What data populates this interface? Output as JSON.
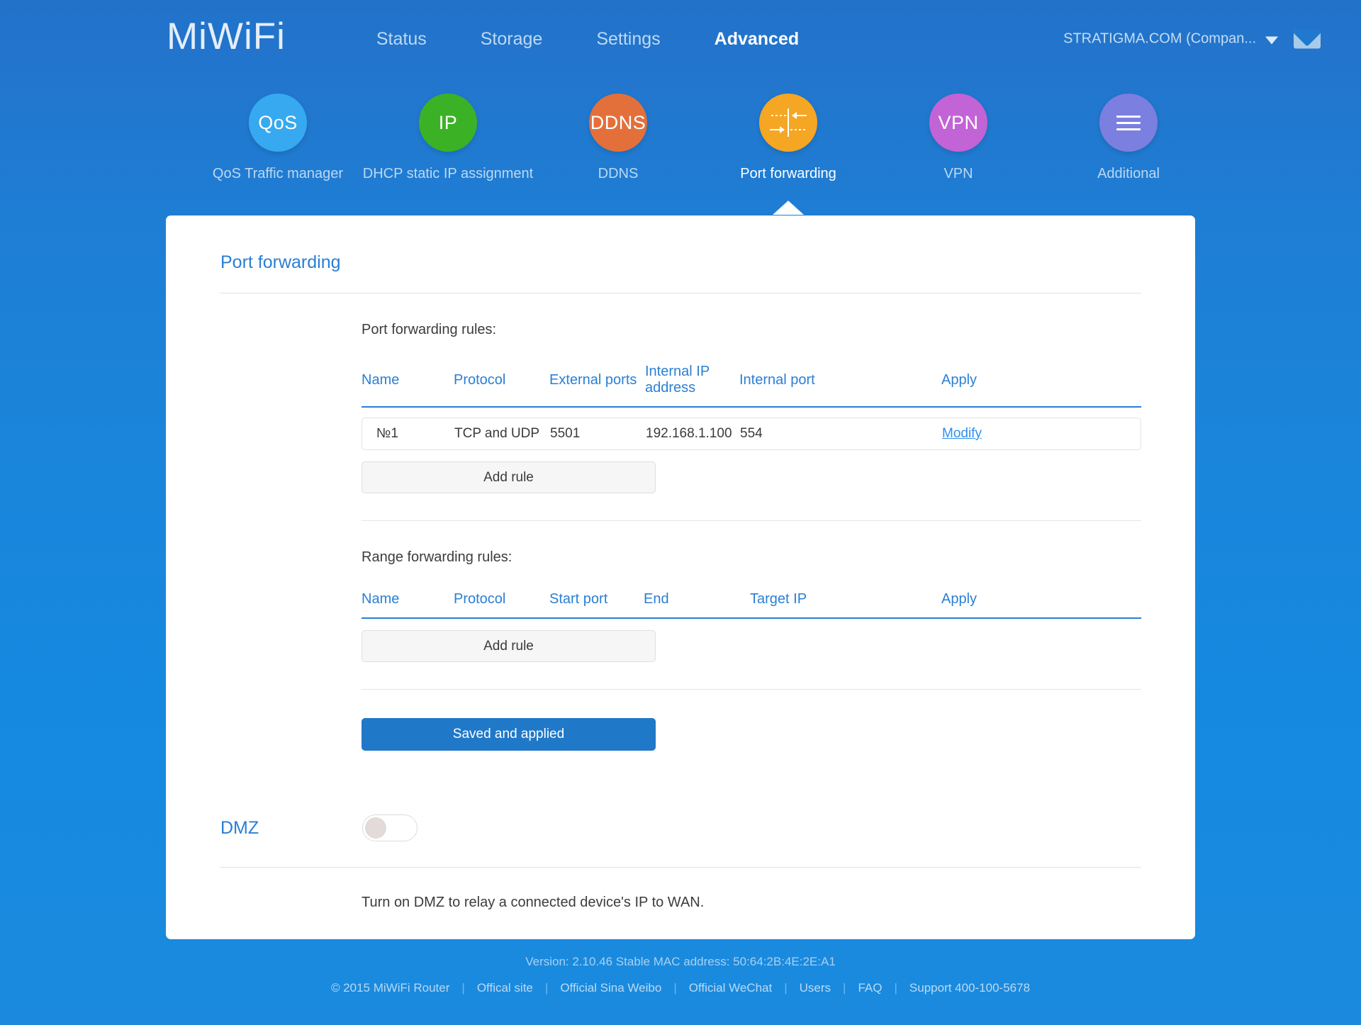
{
  "header": {
    "brand": "MiWiFi",
    "nav": [
      {
        "label": "Status",
        "active": false
      },
      {
        "label": "Storage",
        "active": false
      },
      {
        "label": "Settings",
        "active": false
      },
      {
        "label": "Advanced",
        "active": true
      }
    ],
    "account": "STRATIGMA.COM (Compan...",
    "chevron_icon": "chevron-down-icon",
    "mail_icon": "envelope-icon"
  },
  "iconnav": [
    {
      "glyph": "QoS",
      "caption": "QoS Traffic manager",
      "color": "#36a9f0",
      "icon": "qos-icon"
    },
    {
      "glyph": "IP",
      "caption": "DHCP static IP assignment",
      "color": "#3bb226",
      "icon": "ip-icon"
    },
    {
      "glyph": "DDNS",
      "caption": "DDNS",
      "color": "#e3703a",
      "icon": "ddns-icon"
    },
    {
      "glyph": "",
      "caption": "Port forwarding",
      "color": "#f5a623",
      "icon": "port-forwarding-icon"
    },
    {
      "glyph": "VPN",
      "caption": "VPN",
      "color": "#c263d6",
      "icon": "vpn-icon"
    },
    {
      "glyph": "",
      "caption": "Additional",
      "color": "#7b7fe0",
      "icon": "hamburger-icon"
    }
  ],
  "panel": {
    "title": "Port forwarding",
    "port_rules": {
      "label": "Port forwarding rules:",
      "columns": [
        "Name",
        "Protocol",
        "External ports",
        "Internal IP address",
        "Internal port",
        "Apply"
      ],
      "rows": [
        {
          "name": "№1",
          "protocol": "TCP and UDP",
          "external_ports": "5501",
          "internal_ip": "192.168.1.100",
          "internal_port": "554",
          "apply": "Modify"
        }
      ],
      "add_label": "Add rule"
    },
    "range_rules": {
      "label": "Range forwarding rules:",
      "columns": [
        "Name",
        "Protocol",
        "Start port",
        "End",
        "Target IP",
        "Apply"
      ],
      "rows": [],
      "add_label": "Add rule"
    },
    "save_label": "Saved and applied",
    "dmz": {
      "label": "DMZ",
      "enabled": false,
      "description": "Turn on DMZ to relay a connected device's IP to WAN."
    }
  },
  "footer": {
    "version": "Version: 2.10.46 Stable  MAC address: 50:64:2B:4E:2E:A1",
    "copyright": "© 2015 MiWiFi Router",
    "links": [
      "Offical site",
      "Official Sina Weibo",
      "Official WeChat",
      "Users",
      "FAQ",
      "Support 400-100-5678"
    ],
    "separator": "|"
  },
  "colors": {
    "accent": "#2a7fd4",
    "primary_button": "#2078c8",
    "link": "#2d8ff0",
    "page_bg_top": "#2272ca",
    "page_bg_bottom": "#1589e0"
  }
}
